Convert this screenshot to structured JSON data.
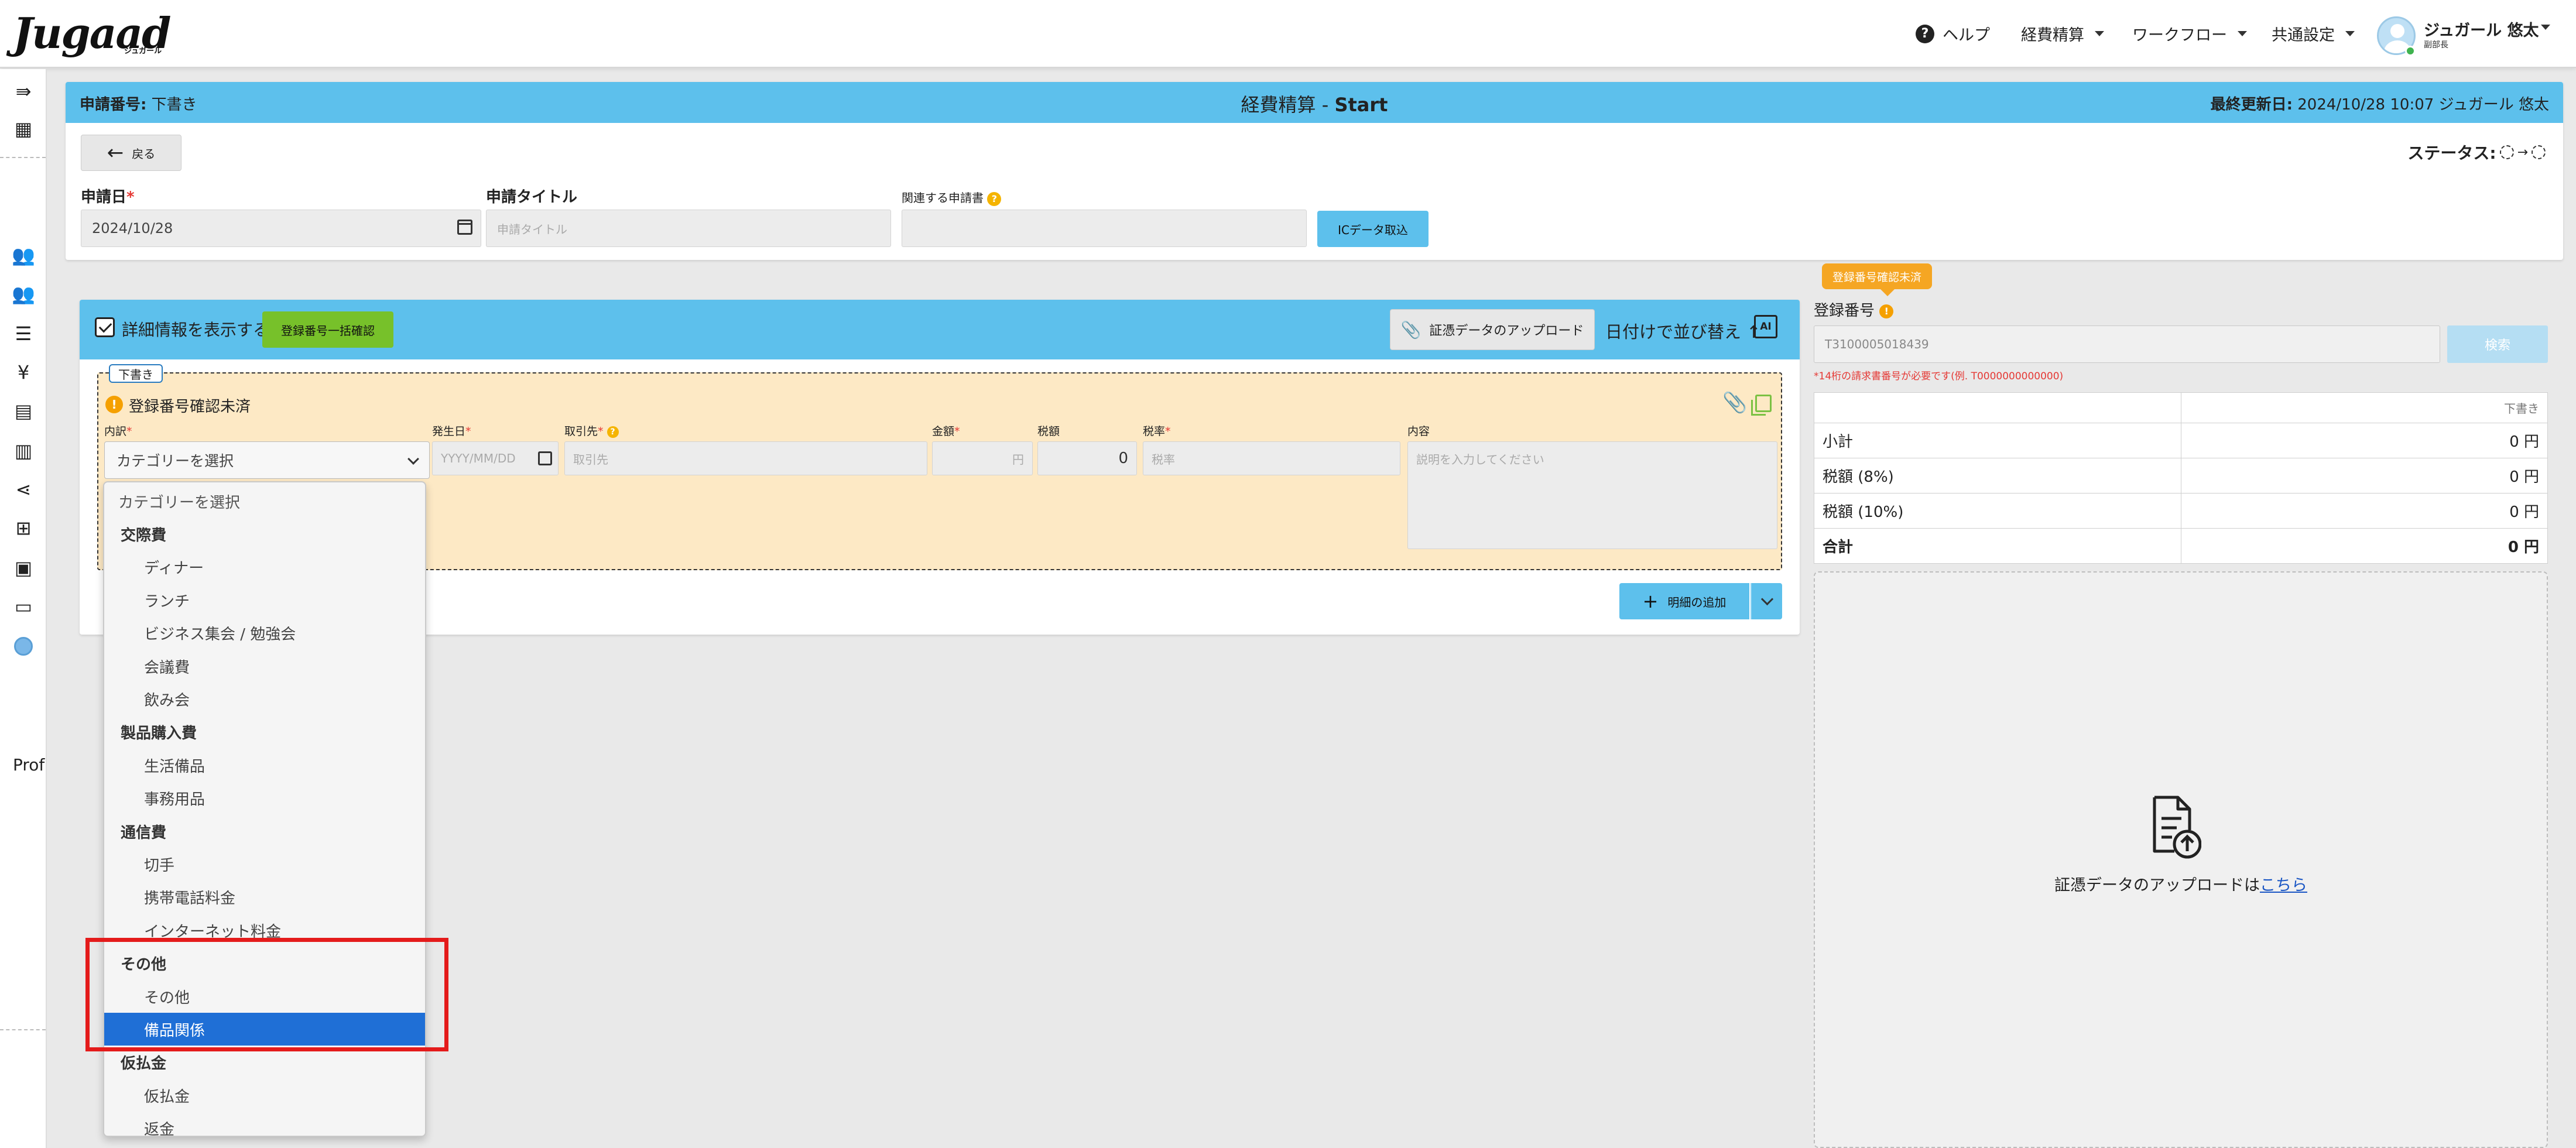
{
  "app": {
    "logo": "Jugaad",
    "logo_sub": "ジュガール"
  },
  "topnav": {
    "help": "ヘルプ",
    "expense": "経費精算",
    "workflow": "ワークフロー",
    "settings": "共通設定",
    "user_name": "ジュガール 悠太",
    "user_dept": "副部長"
  },
  "sidebar": {
    "prof_label": "Prof"
  },
  "header": {
    "application_no_label": "申請番号:",
    "application_no_value": "下書き",
    "title_prefix": "経費精算 - ",
    "title_value": "Start",
    "last_updated_label": "最終更新日:",
    "last_updated_value": "2024/10/28 10:07 ジュガール 悠太",
    "back_label": "戻る",
    "status_label": "ステータス:"
  },
  "form": {
    "date_label": "申請日",
    "date_value": "2024/10/28",
    "title_label": "申請タイトル",
    "title_placeholder": "申請タイトル",
    "related_label": "関連する申請書",
    "ic_button": "ICデータ取込"
  },
  "detail": {
    "show_detail": "詳細情報を表示する",
    "bulk_check": "登録番号一括確認",
    "upload_button": "証憑データのアップロード",
    "sort_label": "日付けで並び替え ↑",
    "ai_label": "AI",
    "draft_badge": "下書き",
    "unverified": "登録番号確認未済",
    "columns": {
      "category": "内訳",
      "date": "発生日",
      "vendor": "取引先",
      "amount": "金額",
      "tax": "税額",
      "tax_rate": "税率",
      "content": "内容"
    },
    "cells": {
      "category_value": "カテゴリーを選択",
      "date_placeholder": "YYYY/MM/DD",
      "vendor_placeholder": "取引先",
      "amount_unit": "円",
      "tax_value": "0",
      "tax_rate_placeholder": "税率",
      "content_placeholder": "説明を入力してください"
    },
    "add_button": "明細の追加"
  },
  "dropdown": {
    "items": [
      {
        "label": "カテゴリーを選択",
        "kind": "first"
      },
      {
        "label": "交際費",
        "kind": "group"
      },
      {
        "label": "ディナー",
        "kind": "opt"
      },
      {
        "label": "ランチ",
        "kind": "opt"
      },
      {
        "label": "ビジネス集会 / 勉強会",
        "kind": "opt"
      },
      {
        "label": "会議費",
        "kind": "opt"
      },
      {
        "label": "飲み会",
        "kind": "opt"
      },
      {
        "label": "製品購入費",
        "kind": "group"
      },
      {
        "label": "生活備品",
        "kind": "opt"
      },
      {
        "label": "事務用品",
        "kind": "opt"
      },
      {
        "label": "通信費",
        "kind": "group"
      },
      {
        "label": "切手",
        "kind": "opt"
      },
      {
        "label": "携帯電話料金",
        "kind": "opt"
      },
      {
        "label": "インターネット料金",
        "kind": "opt"
      },
      {
        "label": "その他",
        "kind": "group"
      },
      {
        "label": "その他",
        "kind": "opt"
      },
      {
        "label": "備品関係",
        "kind": "opt",
        "selected": true
      },
      {
        "label": "仮払金",
        "kind": "group"
      },
      {
        "label": "仮払金",
        "kind": "opt"
      },
      {
        "label": "返金",
        "kind": "opt"
      }
    ]
  },
  "right_panel": {
    "tooltip": "登録番号確認未済",
    "reg_label": "登録番号",
    "reg_value": "T3100005018439",
    "search_button": "検索",
    "hint": "*14桁の請求書番号が必要です(例. T0000000000000)",
    "totals_header": "下書き",
    "rows": [
      {
        "label": "小計",
        "value": "0 円"
      },
      {
        "label": "税額 (8%)",
        "value": "0 円"
      },
      {
        "label": "税額 (10%)",
        "value": "0 円"
      },
      {
        "label": "合計",
        "value": "0 円"
      }
    ],
    "dropzone_text": "証憑データのアップロードは",
    "dropzone_link": "こちら"
  },
  "colors": {
    "accent": "#5dc0ec",
    "green": "#77c12a",
    "draft_row": "#fde9c5",
    "selected": "#1f6fd6",
    "highlight": "#e41b1b",
    "warning": "#f5a623"
  }
}
